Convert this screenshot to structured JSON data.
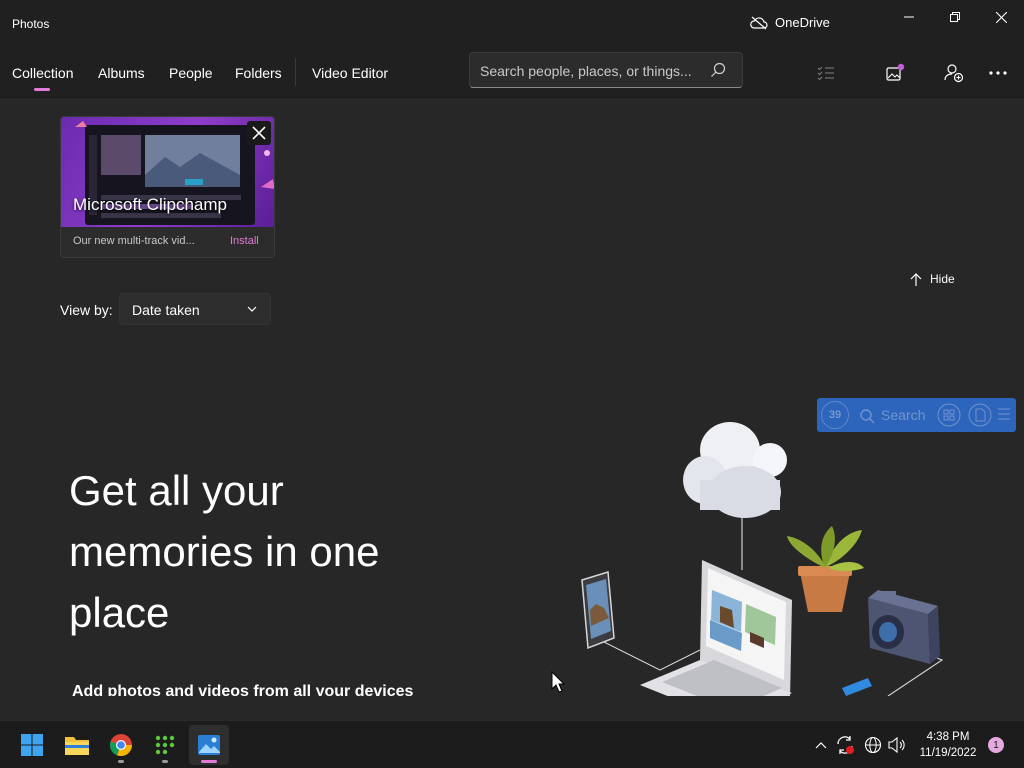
{
  "window": {
    "title": "Photos",
    "onedrive_label": "OneDrive"
  },
  "nav": {
    "tabs": [
      {
        "label": "Collection",
        "selected": true
      },
      {
        "label": "Albums"
      },
      {
        "label": "People"
      },
      {
        "label": "Folders"
      },
      {
        "label": "Video Editor"
      }
    ],
    "search_placeholder": "Search people, places, or things...",
    "accent_color": "#e17ad9"
  },
  "promo": {
    "title": "Microsoft Clipchamp",
    "description": "Our new multi-track vid...",
    "install_label": "Install"
  },
  "hide_label": "Hide",
  "view_by": {
    "label": "View by:",
    "value": "Date taken"
  },
  "hero": {
    "line1": "Get all your",
    "line2": "memories in one",
    "line3": "place",
    "subtitle": "Add photos and videos from all your devices"
  },
  "widget": {
    "badge": "39",
    "search_label": "Search"
  },
  "taskbar": {
    "apps": [
      "start-icon",
      "file-explorer-icon",
      "chrome-icon",
      "app-grid-icon",
      "photos-icon"
    ],
    "time": "4:38 PM",
    "date": "11/19/2022",
    "notification_count": "1"
  }
}
